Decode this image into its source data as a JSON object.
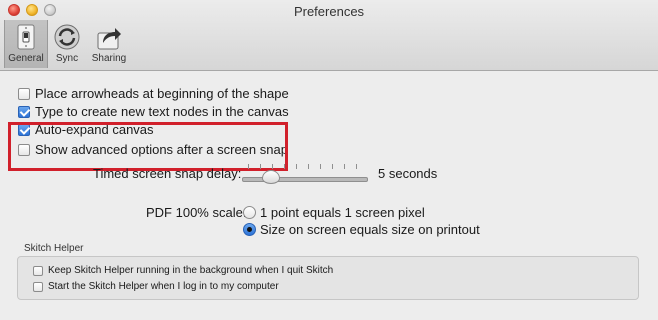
{
  "window": {
    "title": "Preferences"
  },
  "toolbar": {
    "items": [
      {
        "label": "General",
        "icon": "light-switch-icon",
        "selected": true
      },
      {
        "label": "Sync",
        "icon": "sync-icon",
        "selected": false
      },
      {
        "label": "Sharing",
        "icon": "share-arrow-icon",
        "selected": false
      }
    ]
  },
  "options": {
    "arrowheads": {
      "label": "Place arrowheads at beginning of the shape",
      "checked": false
    },
    "type_text": {
      "label": "Type to create new text nodes in the canvas",
      "checked": true
    },
    "auto_expand": {
      "label": "Auto-expand canvas",
      "checked": true
    },
    "advanced": {
      "label": "Show advanced options after a screen snap",
      "checked": false
    }
  },
  "snap_delay": {
    "label": "Timed screen snap delay:",
    "value_text": "5 seconds",
    "level": 0.2
  },
  "pdf_scale": {
    "label": "PDF 100% scale:",
    "options": [
      {
        "label": "1 point equals 1 screen pixel",
        "selected": false
      },
      {
        "label": "Size on screen equals size on printout",
        "selected": true
      }
    ]
  },
  "skitch_helper": {
    "title": "Skitch Helper",
    "options": [
      {
        "label": "Keep Skitch Helper running in the background when I quit Skitch",
        "checked": false
      },
      {
        "label": "Start the Skitch Helper when I log in to my computer",
        "checked": false
      }
    ]
  },
  "colors": {
    "highlight": "#d1202b",
    "accent": "#2d73d8"
  }
}
